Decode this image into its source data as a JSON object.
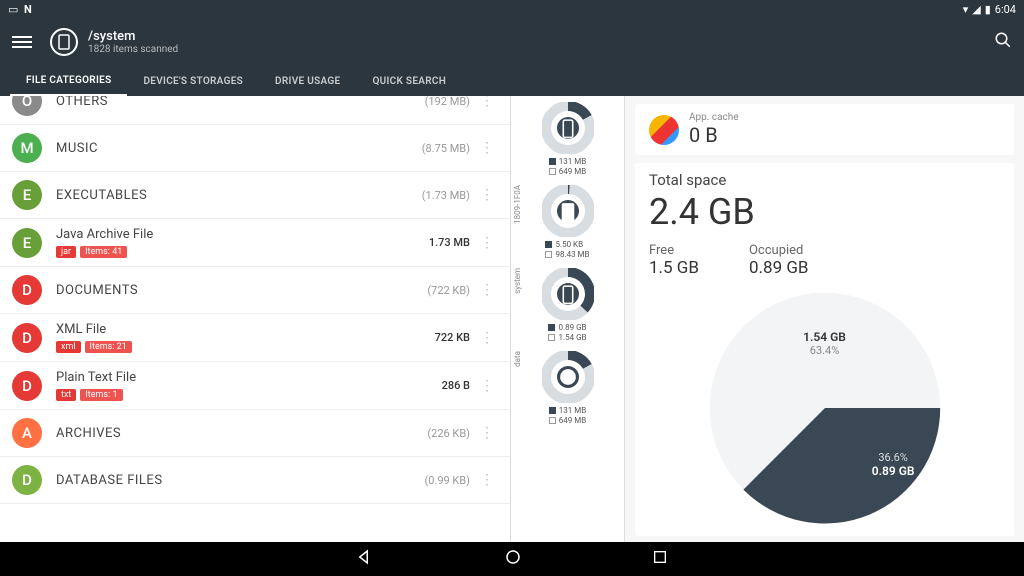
{
  "status": {
    "time": "6:04"
  },
  "header": {
    "path": "/system",
    "subtitle": "1828 items scanned"
  },
  "tabs": [
    "FILE CATEGORIES",
    "DEVICE'S STORAGES",
    "DRIVE USAGE",
    "QUICK SEARCH"
  ],
  "colors": {
    "others": "#8a8a8a",
    "music": "#4caf50",
    "exec": "#689f38",
    "exec2": "#689f38",
    "doc": "#e53935",
    "arch": "#ff7043",
    "db": "#7cb342",
    "badge_ext": "#e53935",
    "badge_items": "#ef5350"
  },
  "categories": [
    {
      "letter": "O",
      "color": "others",
      "title": "OTHERS",
      "size": "(192 MB)",
      "type": "cat",
      "cut": true
    },
    {
      "letter": "M",
      "color": "music",
      "title": "MUSIC",
      "size": "(8.75 MB)",
      "type": "cat"
    },
    {
      "letter": "E",
      "color": "exec",
      "title": "EXECUTABLES",
      "size": "(1.73 MB)",
      "type": "cat"
    },
    {
      "letter": "E",
      "color": "exec2",
      "title": "Java Archive File",
      "size": "1.73 MB",
      "type": "sub",
      "ext": "jar",
      "items": "Items: 41"
    },
    {
      "letter": "D",
      "color": "doc",
      "title": "DOCUMENTS",
      "size": "(722 KB)",
      "type": "cat"
    },
    {
      "letter": "D",
      "color": "doc",
      "title": "XML File",
      "size": "722 KB",
      "type": "sub",
      "ext": "xml",
      "items": "Items: 21"
    },
    {
      "letter": "D",
      "color": "doc",
      "title": "Plain Text File",
      "size": "286 B",
      "type": "sub",
      "ext": "txt",
      "items": "Items: 1"
    },
    {
      "letter": "A",
      "color": "arch",
      "title": "ARCHIVES",
      "size": "(226 KB)",
      "type": "cat"
    },
    {
      "letter": "D",
      "color": "db",
      "title": "DATABASE FILES",
      "size": "(0.99 KB)",
      "type": "cat"
    }
  ],
  "donuts": [
    {
      "label": "",
      "used": "131 MB",
      "free": "649 MB",
      "pct": 17,
      "icon": "phone"
    },
    {
      "label": "1809-1F0A",
      "used": "5.50 KB",
      "free": "98.43 MB",
      "pct": 1,
      "icon": "sd"
    },
    {
      "label": "system",
      "used": "0.89 GB",
      "free": "1.54 GB",
      "pct": 37,
      "icon": "phone"
    },
    {
      "label": "data",
      "used": "131 MB",
      "free": "649 MB",
      "pct": 17,
      "icon": "android"
    }
  ],
  "cache": {
    "label": "App. cache",
    "value": "0 B"
  },
  "space": {
    "title": "Total space",
    "total": "2.4 GB",
    "free_label": "Free",
    "free": "1.5 GB",
    "occ_label": "Occupied",
    "occ": "0.89 GB"
  },
  "chart_data": {
    "type": "pie",
    "title": "Total space",
    "series": [
      {
        "name": "Free",
        "value": 1.54,
        "label": "1.54 GB",
        "pct": "63.4%"
      },
      {
        "name": "Occupied",
        "value": 0.89,
        "label": "0.89 GB",
        "pct": "36.6%"
      }
    ]
  }
}
